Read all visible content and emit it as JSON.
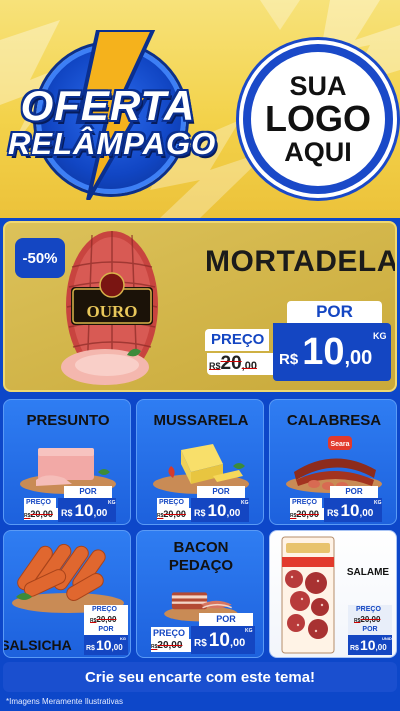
{
  "header": {
    "offer_line1": "OFERTA",
    "offer_line2": "RELÂMPAGO",
    "logo_line1": "SUA",
    "logo_line2": "LOGO",
    "logo_line3": "AQUI"
  },
  "hero": {
    "discount": "-50%",
    "brand": "OURO",
    "title": "MORTADELA",
    "por": "POR",
    "preco": "PREÇO",
    "old_prefix": "R$",
    "old_int": "20",
    "old_dec": ",00",
    "currency": "R$",
    "new_int": "10",
    "new_dec": ",00",
    "unit": "KG"
  },
  "products": [
    {
      "name": "PRESUNTO",
      "por": "POR",
      "preco": "PREÇO",
      "old": "20,00",
      "old_prefix": "R$",
      "currency": "R$",
      "int": "10",
      "dec": ",00",
      "unit": "KG"
    },
    {
      "name": "MUSSARELA",
      "por": "POR",
      "preco": "PREÇO",
      "old": "20,00",
      "old_prefix": "R$",
      "currency": "R$",
      "int": "10",
      "dec": ",00",
      "unit": "KG"
    },
    {
      "name": "CALABRESA",
      "brand": "Seara",
      "por": "POR",
      "preco": "PREÇO",
      "old": "20,00",
      "old_prefix": "R$",
      "currency": "R$",
      "int": "10",
      "dec": ",00",
      "unit": "KG"
    },
    {
      "name": "SALSICHA",
      "por": "POR",
      "preco": "PREÇO",
      "old": "20,00",
      "old_prefix": "R$",
      "currency": "R$",
      "int": "10",
      "dec": ",00",
      "unit": "KG"
    },
    {
      "name_line1": "BACON",
      "name_line2": "PEDAÇO",
      "por": "POR",
      "preco": "PREÇO",
      "old": "20,00",
      "old_prefix": "R$",
      "currency": "R$",
      "int": "10",
      "dec": ",00",
      "unit": "KG"
    },
    {
      "name": "SALAME",
      "por": "POR",
      "preco": "PREÇO",
      "old": "20,00",
      "old_prefix": "R$",
      "currency": "R$",
      "int": "10",
      "dec": ",00",
      "unit": "UNID"
    }
  ],
  "footer": {
    "cta": "Crie seu encarte com este tema!",
    "note": "*Imagens Meramente Ilustrativas"
  },
  "colors": {
    "brand_blue": "#1446c2",
    "card_blue": "#2f7df2",
    "hero_gold": "#c9a93a",
    "header_yellow": "#f3d24a",
    "strike_red": "#cc0000"
  },
  "icons": [
    "lightning-bolt-icon",
    "mortadela-image",
    "ham-image",
    "cheese-image",
    "sausage-image",
    "hotdog-image",
    "bacon-image",
    "salami-image"
  ]
}
